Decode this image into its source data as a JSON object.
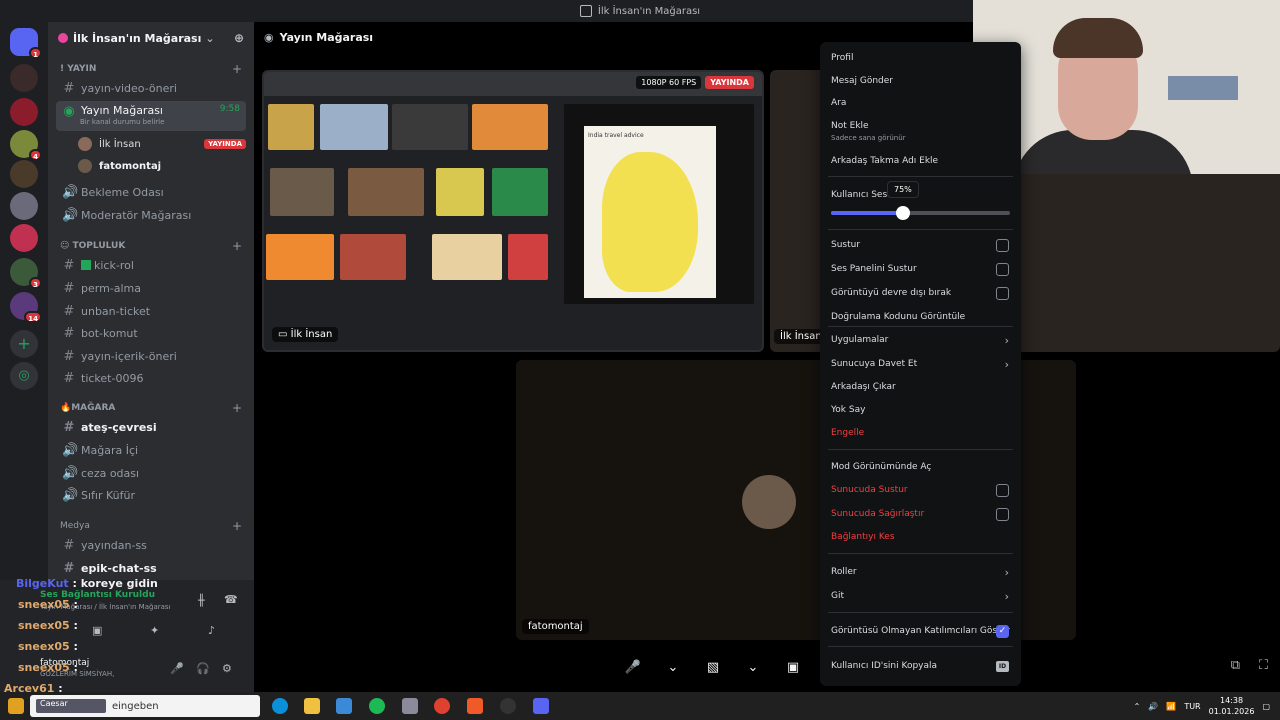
{
  "window": {
    "title": "İlk İnsan'ın Mağarası"
  },
  "server": {
    "name": "İlk İnsan'ın Mağarası"
  },
  "categories": {
    "yayin": "YAYIN",
    "topluluk": "TOPLULUK",
    "magara": "MAĞARA",
    "medya": "Medya"
  },
  "channels": {
    "yayin_video": "yayın-video-öneri",
    "yayin_magarasi": "Yayın Mağarası",
    "yayin_magarasi_timer": "9:58",
    "yayin_magarasi_status": "Bir kanal durumu belirle",
    "bekleme": "Bekleme Odası",
    "moderator": "Moderatör Mağarası",
    "kick_rol": "kick-rol",
    "perm_alma": "perm-alma",
    "unban": "unban-ticket",
    "bot_komut": "bot-komut",
    "yayin_icerik": "yayın-içerik-öneri",
    "ticket": "ticket-0096",
    "ates": "ateş-çevresi",
    "magara_ici": "Mağara İçi",
    "ceza": "ceza odası",
    "sifir_kufur": "Sıfır Küfür",
    "yayindan_ss": "yayından-ss",
    "epik_chat": "epik-chat-ss"
  },
  "voice_users": [
    {
      "name": "İlk İnsan",
      "badge": "YAYINDA"
    },
    {
      "name": "fatomontaj"
    }
  ],
  "overlay_chat": [
    {
      "user": "BilgeKut",
      "text": ": koreye gidin"
    },
    {
      "user": "sneex05",
      "text": ":"
    },
    {
      "user": "sneex05",
      "text": ":"
    },
    {
      "user": "sneex05",
      "text": ":"
    },
    {
      "user": "sneex05",
      "text": ":"
    },
    {
      "user": "Arcey61",
      "text": ":"
    }
  ],
  "user_panel": {
    "connection": "Ses Bağlantısı Kuruldu",
    "location": "Yayın Mağarası / İlk İnsan'ın Mağarası",
    "username": "fatomontaj",
    "status": "GÖZLERİM SİMSİYAH,"
  },
  "stage": {
    "title": "Yayın Mağarası",
    "quality": "1080P 60 FPS",
    "live": "YAYINDA",
    "stream_label": "İlk İnsan",
    "tile2_label": "İlk İnsan",
    "tile3_label": "fatomontaj",
    "browser_panel_title": "India travel advice"
  },
  "context_menu": {
    "profil": "Profil",
    "mesaj": "Mesaj Gönder",
    "ara": "Ara",
    "not_ekle": "Not Ekle",
    "not_sub": "Sadece sana görünür",
    "takma_ad": "Arkadaş Takma Adı Ekle",
    "kullanici_ses": "Kullanıcı Ses",
    "volume_pct": "75%",
    "volume_fraction": 0.4,
    "sustur": "Sustur",
    "ses_paneli": "Ses Panelini Sustur",
    "goruntu_devre": "Görüntüyü devre dışı bırak",
    "dogrulama": "Doğrulama Kodunu Görüntüle",
    "uygulamalar": "Uygulamalar",
    "davet": "Sunucuya Davet Et",
    "arkadas_cikar": "Arkadaşı Çıkar",
    "yok_say": "Yok Say",
    "engelle": "Engelle",
    "mod_gorunum": "Mod Görünümünde Aç",
    "sunucuda_sustur": "Sunucuda Sustur",
    "sunucuda_sagir": "Sunucuda Sağırlaştır",
    "baglanti_kes": "Bağlantıyı Kes",
    "roller": "Roller",
    "git": "Git",
    "goruntusu_olmayan": "Görüntüsü Olmayan Katılımcıları Göster",
    "id_kopyala": "Kullanıcı ID'sini Kopyala",
    "id_icon_text": "ID"
  },
  "taskbar": {
    "search_text": "eingeben",
    "search_prefix": "Caesar",
    "lang": "TUR",
    "time": "14:38",
    "date": "01.01.2026"
  },
  "colors": {
    "accent": "#5865f2",
    "danger": "#f23f43",
    "live": "#da373c"
  }
}
